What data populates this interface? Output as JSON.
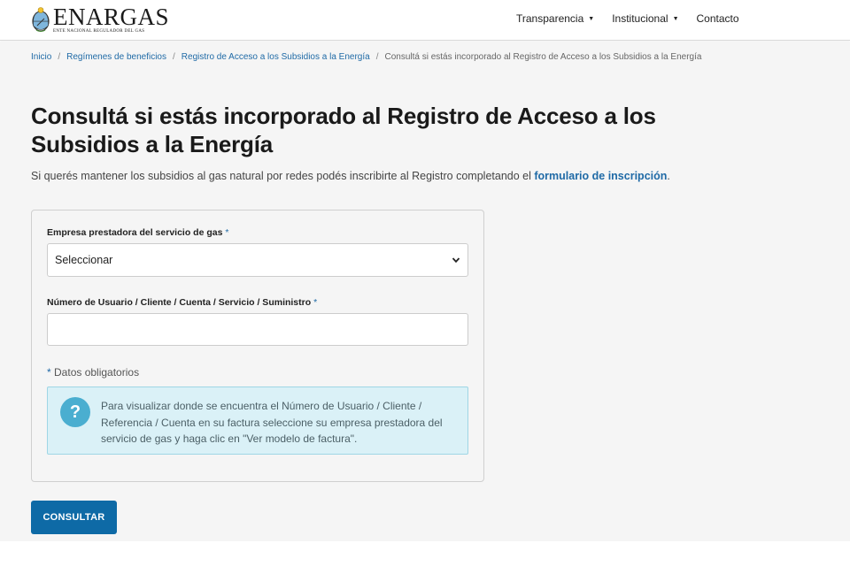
{
  "brand": {
    "name": "ENARGAS",
    "subtitle": "ENTE NACIONAL REGULADOR DEL GAS"
  },
  "nav": {
    "items": [
      {
        "label": "Transparencia",
        "has_dropdown": true
      },
      {
        "label": "Institucional",
        "has_dropdown": true
      },
      {
        "label": "Contacto",
        "has_dropdown": false
      }
    ]
  },
  "breadcrumb": {
    "items": [
      "Inicio",
      "Regímenes de beneficios",
      "Registro de Acceso a los Subsidios a la Energía"
    ],
    "separator": "/",
    "current": "Consultá si estás incorporado al Registro de Acceso a los Subsidios a la Energía"
  },
  "page": {
    "title": "Consultá si estás incorporado al Registro de Acceso a los Subsidios a la Energía",
    "lead_text": "Si querés mantener los subsidios al gas natural por redes podés inscribirte al Registro completando el ",
    "lead_link": "formulario de inscripción",
    "lead_end": "."
  },
  "form": {
    "company_label": "Empresa prestadora del servicio de gas",
    "company_value": "Seleccionar",
    "user_number_label": "Número de Usuario / Cliente / Cuenta / Servicio / Suministro",
    "user_number_value": "",
    "required_mark": "*",
    "required_note": "Datos obligatorios",
    "info_text": "Para visualizar donde se encuentra el Número de Usuario / Cliente / Referencia / Cuenta en su factura seleccione su empresa prestadora del servicio de gas y haga clic en \"Ver modelo de factura\".",
    "submit_label": "CONSULTAR"
  },
  "icons": {
    "dropdown": "caret-down-icon",
    "select": "chevron-down-icon",
    "info": "question-circle-icon"
  },
  "colors": {
    "link": "#1f6aa6",
    "button": "#0e6aa6",
    "info_bg": "#daf1f7",
    "info_icon": "#4aaed0"
  }
}
